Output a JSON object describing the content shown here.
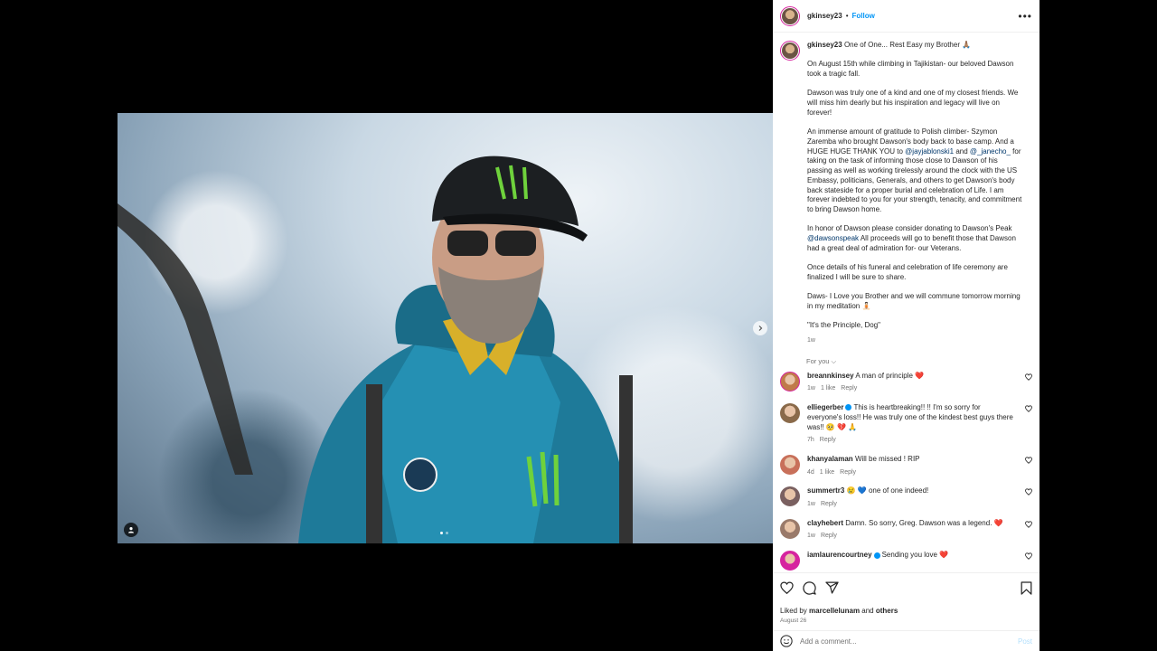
{
  "post": {
    "username": "gkinsey23",
    "follow_label": "Follow",
    "more_label": "•••",
    "caption_title": "One of One... Rest Easy my Brother 🙏🏽",
    "paragraphs": {
      "p1": "On August 15th while climbing in Tajikistan- our beloved Dawson took a tragic fall.",
      "p2": "Dawson was truly one of a kind and one of my closest friends. We will miss him dearly but his inspiration and legacy will live on forever!",
      "p3_a": "An immense amount of gratitude to Polish climber- Szymon Zaremba who brought Dawson's body back to base camp. And a HUGE HUGE THANK YOU to ",
      "p3_m1": "@jayjablonski1",
      "p3_b": " and ",
      "p3_m2": "@_janecho_",
      "p3_c": " for taking on the task of informing those close to Dawson of his passing as well as working tirelessly around the clock with the US Embassy, politicians, Generals, and others to get Dawson's body back stateside for a proper burial and celebration of Life. I am forever indebted to you for your strength, tenacity, and commitment to bring Dawson home.",
      "p4_a": "In honor of Dawson please consider donating to Dawson's Peak ",
      "p4_m": "@dawsonspeak",
      "p4_b": " All proceeds will go to benefit those that Dawson had a great deal of admiration for- our Veterans.",
      "p5": "Once details of his funeral and celebration of life ceremony are finalized I will be sure to share.",
      "p6": "Daws- I Love you Brother and we will commune tomorrow morning in my meditation 🧘🏻",
      "p7": "\"It's the Principle, Dog\""
    },
    "caption_time": "1w",
    "for_you": "For you ⌵",
    "liked_by_prefix": "Liked by ",
    "liked_by_user": "marcellelunam",
    "liked_by_and": " and ",
    "liked_by_others": "others",
    "date": "August 26",
    "comment_placeholder": "Add a comment...",
    "post_label": "Post"
  },
  "comments": [
    {
      "user": "breannkinsey",
      "text": "A man of principle ❤️",
      "time": "1w",
      "likes": "1 like",
      "reply": "Reply",
      "avatar_color": "#c07a4a"
    },
    {
      "user": "elliegerber",
      "text": "This is heartbreaking!! !! I'm so sorry for everyone's loss!! He was truly one of the kindest best guys there was!! 🥺 💔 🙏",
      "time": "7h",
      "likes": "",
      "reply": "Reply",
      "avatar_color": "#8a6a4a"
    },
    {
      "user": "khanyalaman",
      "text": "Will be missed ! RIP",
      "time": "4d",
      "likes": "1 like",
      "reply": "Reply",
      "avatar_color": "#c8705a"
    },
    {
      "user": "summertr3",
      "text": "😢 💙 one of one indeed!",
      "time": "1w",
      "likes": "",
      "reply": "Reply",
      "avatar_color": "#7a6060"
    },
    {
      "user": "clayhebert",
      "text": "Damn. So sorry, Greg. Dawson was a legend. ❤️",
      "time": "1w",
      "likes": "",
      "reply": "Reply",
      "avatar_color": "#9a7a6a"
    },
    {
      "user": "iamlaurencourtney",
      "text": "Sending you love ❤️",
      "time": "",
      "likes": "",
      "reply": "",
      "avatar_color": "#d6249f"
    }
  ],
  "colors": {
    "link": "#00376b",
    "follow": "#0095f6",
    "heart": "#ed4956"
  }
}
